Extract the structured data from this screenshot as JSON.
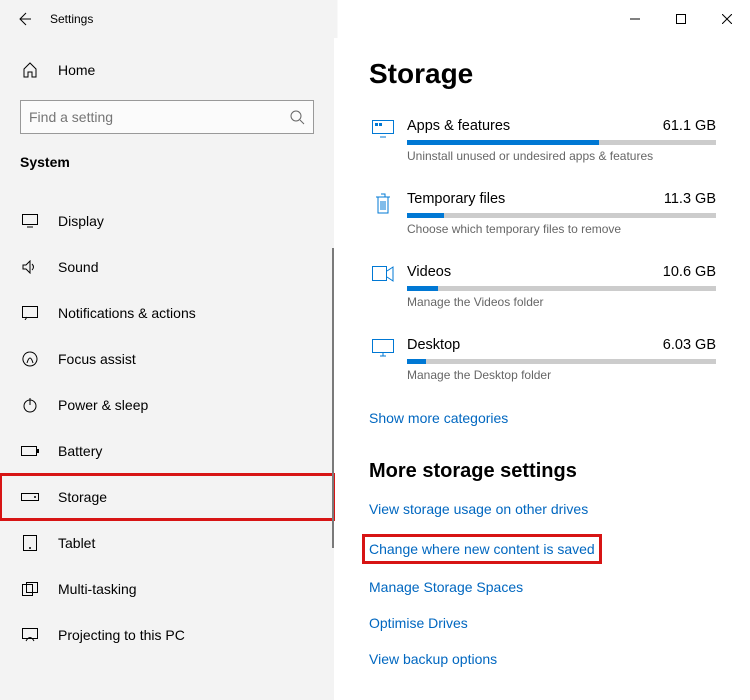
{
  "titlebar": {
    "title": "Settings"
  },
  "sidebar": {
    "home": "Home",
    "search_placeholder": "Find a setting",
    "section": "System",
    "items": [
      {
        "label": "Display"
      },
      {
        "label": "Sound"
      },
      {
        "label": "Notifications & actions"
      },
      {
        "label": "Focus assist"
      },
      {
        "label": "Power & sleep"
      },
      {
        "label": "Battery"
      },
      {
        "label": "Storage"
      },
      {
        "label": "Tablet"
      },
      {
        "label": "Multi-tasking"
      },
      {
        "label": "Projecting to this PC"
      }
    ]
  },
  "content": {
    "heading": "Storage",
    "categories": [
      {
        "name": "Apps & features",
        "size": "61.1 GB",
        "desc": "Uninstall unused or undesired apps & features",
        "fill": 62
      },
      {
        "name": "Temporary files",
        "size": "11.3 GB",
        "desc": "Choose which temporary files to remove",
        "fill": 12
      },
      {
        "name": "Videos",
        "size": "10.6 GB",
        "desc": "Manage the Videos folder",
        "fill": 10
      },
      {
        "name": "Desktop",
        "size": "6.03 GB",
        "desc": "Manage the Desktop folder",
        "fill": 6
      }
    ],
    "show_more": "Show more categories",
    "more_heading": "More storage settings",
    "more_links": [
      "View storage usage on other drives",
      "Change where new content is saved",
      "Manage Storage Spaces",
      "Optimise Drives",
      "View backup options"
    ]
  }
}
